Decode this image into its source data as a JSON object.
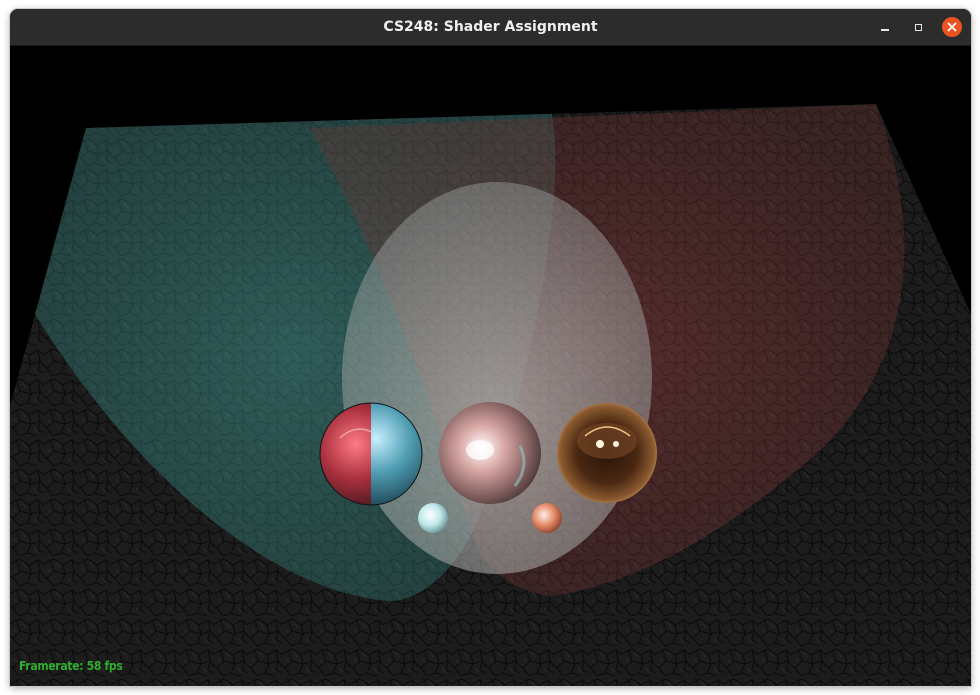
{
  "window": {
    "title": "CS248: Shader Assignment",
    "controls": {
      "minimize_icon": "minimize-icon",
      "maximize_icon": "maximize-icon",
      "close_icon": "close-icon",
      "close_color": "#e95420"
    }
  },
  "scene": {
    "background_color": "#000000",
    "floor_color": "#1c1c1c",
    "lights": [
      {
        "name": "teal spotlight",
        "color": "#4fbfb4"
      },
      {
        "name": "red spotlight",
        "color": "#b94a4a"
      },
      {
        "name": "white spotlight",
        "color": "#e8e2dc"
      }
    ],
    "spheres": [
      {
        "name": "split red/blue sphere",
        "color_a": "#c94a55",
        "color_b": "#4f9db3"
      },
      {
        "name": "pink glossy sphere",
        "color_a": "#d7a6a3",
        "color_b": "#8fd0cf"
      },
      {
        "name": "bronze mirror sphere",
        "color_a": "#6b3e22",
        "color_b": "#d59a60"
      },
      {
        "name": "small cyan sphere",
        "color_a": "#bfe9ea",
        "color_b": "#e3b7b4"
      },
      {
        "name": "small orange sphere",
        "color_a": "#e58a6a",
        "color_b": "#f2d3c4"
      }
    ]
  },
  "status": {
    "framerate_text": "Framerate: 58 fps",
    "framerate_color": "#2fae2f"
  }
}
